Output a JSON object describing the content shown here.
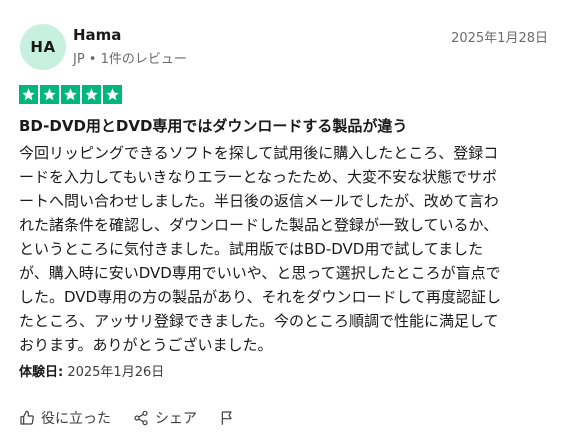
{
  "reviewer": {
    "initials": "HA",
    "name": "Hama",
    "meta": "JP • 1件のレビュー"
  },
  "review": {
    "date": "2025年1月28日",
    "rating": 5,
    "title": "BD-DVD用とDVD専用ではダウンロードする製品が違う",
    "body_lines": [
      "今回リッピングできるソフトを探して試用後に購入したところ、登録コ",
      "ードを入力してもいきなりエラーとなったため、大変不安な状態でサポ",
      "ートへ問い合わせしました。半日後の返信メールでしたが、改めて言わ",
      "れた諸条件を確認し、ダウンロードした製品と登録が一致しているか、",
      "というところに気付きました。試用版ではBD-DVD用で試してました",
      "が、購入時に安いDVD専用でいいや、と思って選択したところが盲点で",
      "した。DVD専用の方の製品があり、それをダウンロードして再度認証し",
      "たところ、アッサリ登録できました。今のところ順調で性能に満足して",
      "おります。ありがとうございました。"
    ],
    "experience_label": "体験日:",
    "experience_date": "2025年1月26日"
  },
  "actions": {
    "helpful_label": "役に立った",
    "share_label": "シェア"
  },
  "colors": {
    "star_green": "#00b67a",
    "avatar_bg": "#c7f0e0"
  }
}
